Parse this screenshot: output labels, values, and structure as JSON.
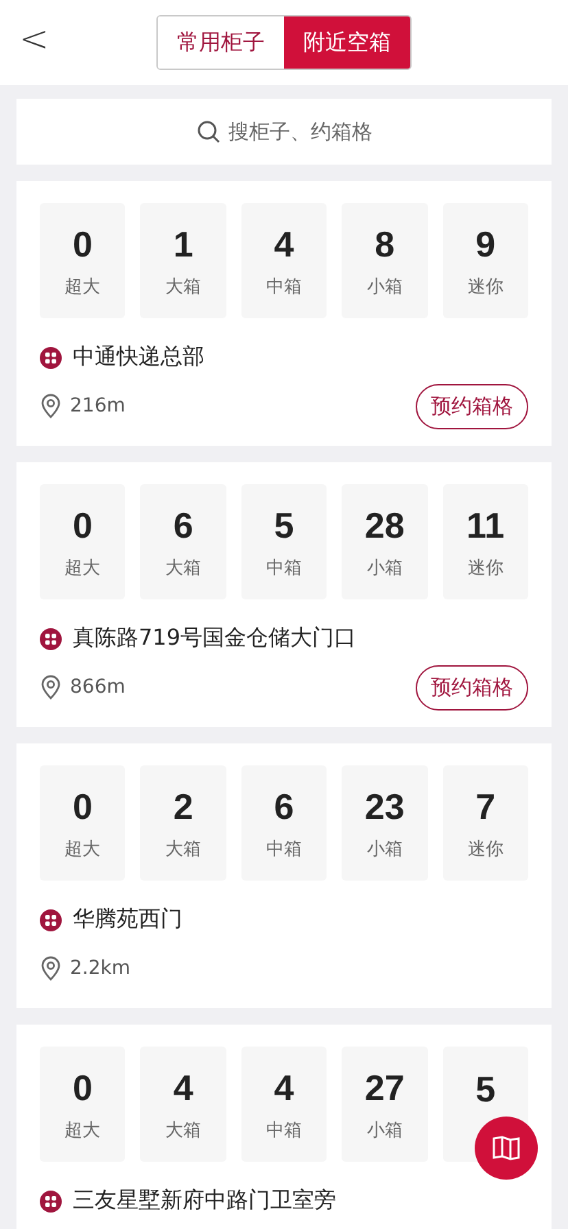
{
  "header": {
    "back": "<",
    "tabs": [
      {
        "label": "常用柜子",
        "selected": false
      },
      {
        "label": "附近空箱",
        "selected": true
      }
    ]
  },
  "search": {
    "placeholder": "搜柜子、约箱格"
  },
  "lockers": [
    {
      "counts": [
        {
          "value": "0",
          "label": "超大"
        },
        {
          "value": "1",
          "label": "大箱"
        },
        {
          "value": "4",
          "label": "中箱"
        },
        {
          "value": "8",
          "label": "小箱"
        },
        {
          "value": "9",
          "label": "迷你"
        }
      ],
      "name": "中通快递总部",
      "distance": "216m",
      "button": "预约箱格"
    },
    {
      "counts": [
        {
          "value": "0",
          "label": "超大"
        },
        {
          "value": "6",
          "label": "大箱"
        },
        {
          "value": "5",
          "label": "中箱"
        },
        {
          "value": "28",
          "label": "小箱"
        },
        {
          "value": "11",
          "label": "迷你"
        }
      ],
      "name": "真陈路719号国金仓储大门口",
      "distance": "866m",
      "button": "预约箱格"
    },
    {
      "counts": [
        {
          "value": "0",
          "label": "超大"
        },
        {
          "value": "2",
          "label": "大箱"
        },
        {
          "value": "6",
          "label": "中箱"
        },
        {
          "value": "23",
          "label": "小箱"
        },
        {
          "value": "7",
          "label": "迷你"
        }
      ],
      "name": "华腾苑西门",
      "distance": "2.2km"
    },
    {
      "counts": [
        {
          "value": "0",
          "label": "超大"
        },
        {
          "value": "4",
          "label": "大箱"
        },
        {
          "value": "4",
          "label": "中箱"
        },
        {
          "value": "27",
          "label": "小箱"
        },
        {
          "value": "5"
        }
      ],
      "name": "三友星墅新府中路门卫室旁"
    }
  ]
}
